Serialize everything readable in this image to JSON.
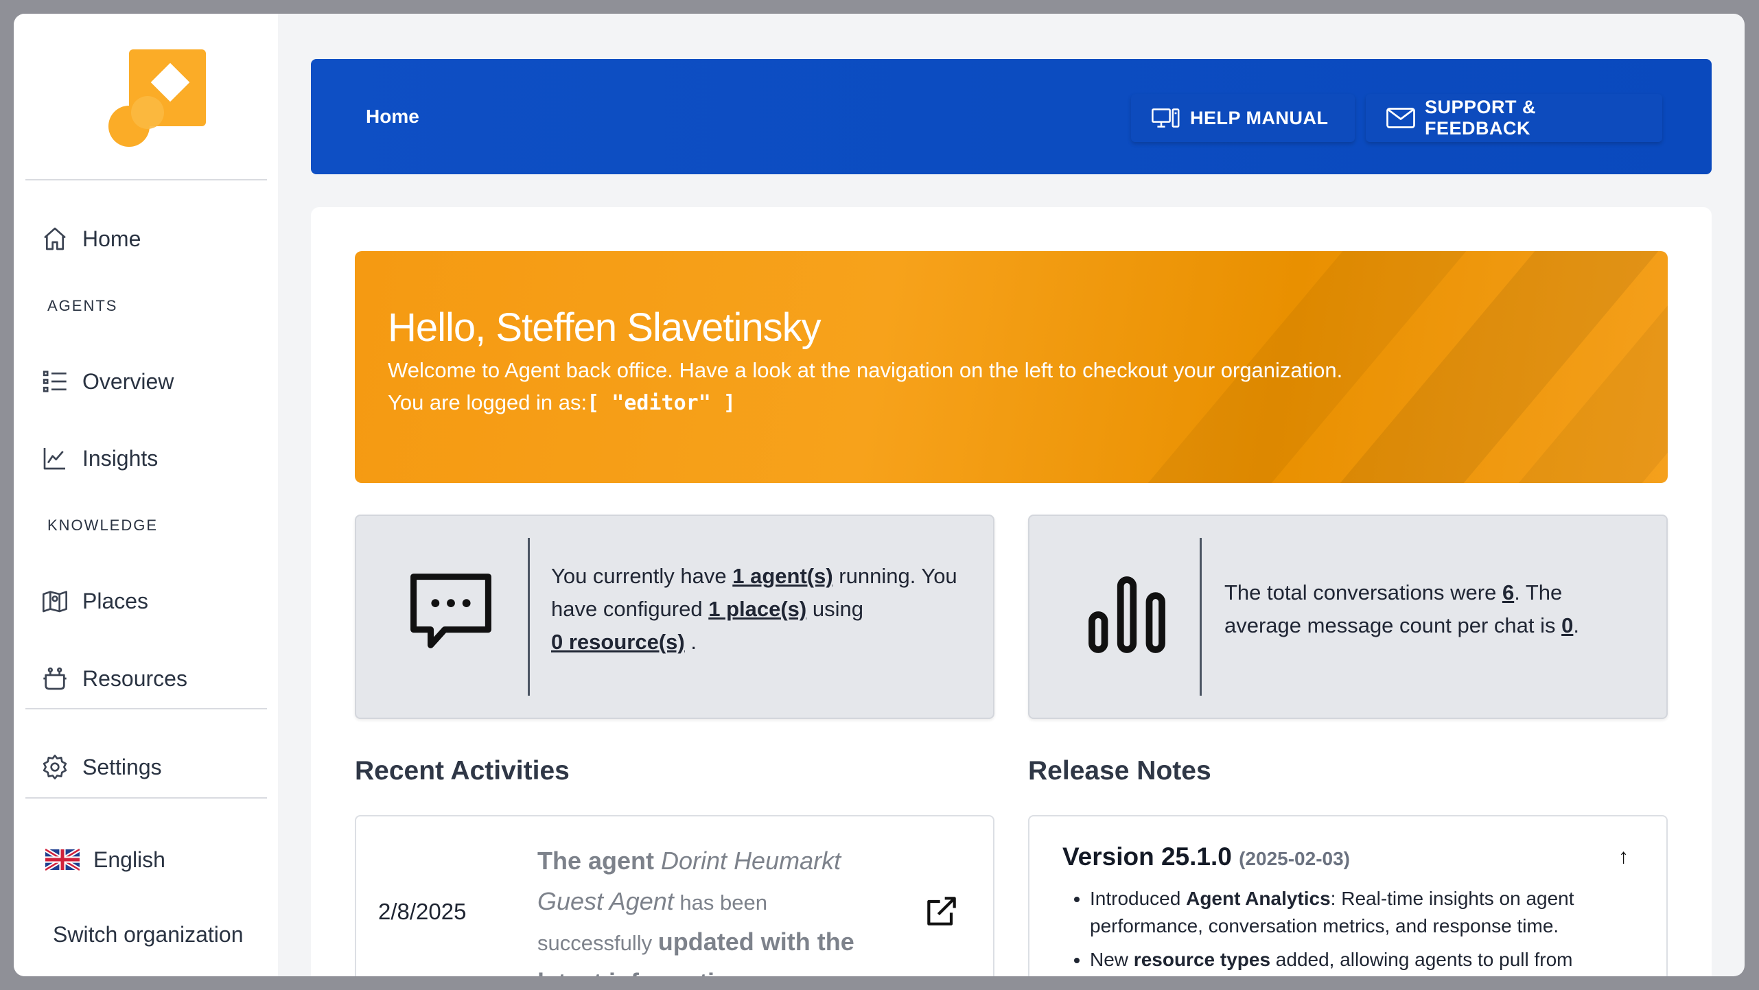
{
  "sidebar": {
    "items": [
      {
        "label": "Home"
      },
      {
        "label": "Overview"
      },
      {
        "label": "Insights"
      },
      {
        "label": "Places"
      },
      {
        "label": "Resources"
      },
      {
        "label": "Settings"
      }
    ],
    "sections": {
      "agents": "AGENTS",
      "knowledge": "KNOWLEDGE"
    },
    "language": "English",
    "switch_org": "Switch organization"
  },
  "header": {
    "breadcrumb": "Home",
    "help_manual": "HELP MANUAL",
    "support_feedback": "SUPPORT & FEEDBACK"
  },
  "hero": {
    "greeting": "Hello, Steffen Slavetinsky",
    "welcome": "Welcome to Agent back office. Have a look at the navigation on the left to checkout your organization.",
    "logged_in_label": "You are logged in as:",
    "role": "[ \"editor\" ]"
  },
  "stats": {
    "agents": {
      "t1": "You currently have ",
      "agents_link": "1 agent(s)",
      "t2": " running. You have configured ",
      "places_link": "1 place(s)",
      "t3": " using",
      "resources_link": "0 resource(s)",
      "t4": " ."
    },
    "conversations": {
      "t1": "The total conversations were ",
      "total": "6",
      "t2": ". The average message count per chat is ",
      "avg": "0",
      "t3": "."
    }
  },
  "recent": {
    "title": "Recent Activities",
    "date": "2/8/2025",
    "p1": "The agent ",
    "agent_name": "Dorint Heumarkt Guest Agent",
    "p2": " has been successfully ",
    "p3": "updated with the latest information"
  },
  "release": {
    "title": "Release Notes",
    "version": "Version 25.1.0",
    "date": "(2025-02-03)",
    "notes": [
      {
        "pre": "Introduced ",
        "bold": "Agent Analytics",
        "post": ": Real-time insights on agent performance, conversation metrics, and response time."
      },
      {
        "pre": "New ",
        "bold": "resource types",
        "post": " added, allowing agents to pull from"
      }
    ]
  },
  "colors": {
    "header_blue": "#0e4fc4",
    "hero_orange": "#f59a12",
    "logo_orange": "#fbac27"
  },
  "icons": [
    "home-icon",
    "overview-icon",
    "insights-icon",
    "places-icon",
    "resources-icon",
    "settings-icon",
    "uk-flag-icon",
    "monitor-icon",
    "mail-icon",
    "chat-bubble-icon",
    "bar-chart-icon",
    "external-link-icon",
    "arrow-up-icon"
  ]
}
